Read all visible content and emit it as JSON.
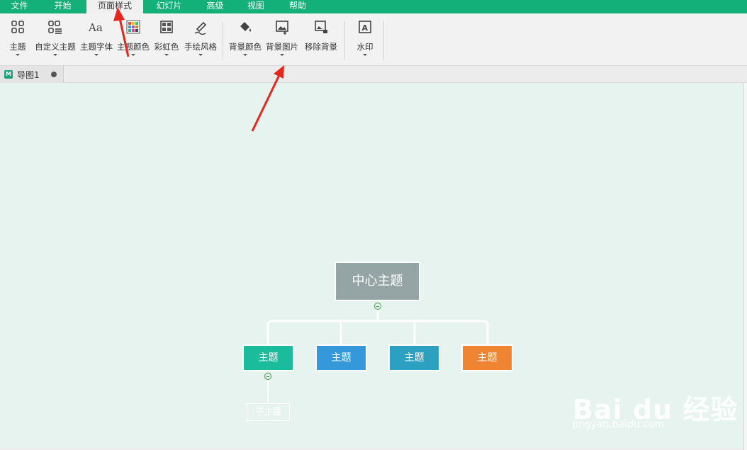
{
  "menubar": {
    "items": [
      "文件",
      "开始",
      "页面样式",
      "幻灯片",
      "高级",
      "视图",
      "帮助"
    ],
    "active_index": 2
  },
  "ribbon": {
    "buttons": [
      {
        "label": "主题",
        "icon": "theme-grid-icon"
      },
      {
        "label": "自定义主题",
        "icon": "custom-theme-icon"
      },
      {
        "label": "主题字体",
        "icon": "font-aa-icon"
      },
      {
        "label": "主题颜色",
        "icon": "color-palette-icon"
      },
      {
        "label": "彩虹色",
        "icon": "rainbow-grid-icon"
      },
      {
        "label": "手绘风格",
        "icon": "pen-icon"
      },
      {
        "label": "背景颜色",
        "icon": "paint-bucket-icon"
      },
      {
        "label": "背景图片",
        "icon": "image-icon"
      },
      {
        "label": "移除背景",
        "icon": "remove-image-icon"
      },
      {
        "label": "水印",
        "icon": "watermark-icon"
      }
    ]
  },
  "doc_tab": {
    "name": "导图1",
    "icon_letter": "M"
  },
  "mindmap": {
    "central_topic": "中心主题",
    "topics": [
      {
        "label": "主题",
        "color": "#1abc9c"
      },
      {
        "label": "主题",
        "color": "#3498db"
      },
      {
        "label": "主题",
        "color": "#2ca0c0"
      },
      {
        "label": "主题",
        "color": "#ef8433"
      }
    ],
    "subtopic": "子主题"
  },
  "colors": {
    "accent": "#13b07a",
    "canvas_bg": "#e7f3ef",
    "annotation_arrow": "#e8261c"
  },
  "watermark": {
    "big": "Bai du 经验",
    "small": "jingyan.baidu.com"
  }
}
